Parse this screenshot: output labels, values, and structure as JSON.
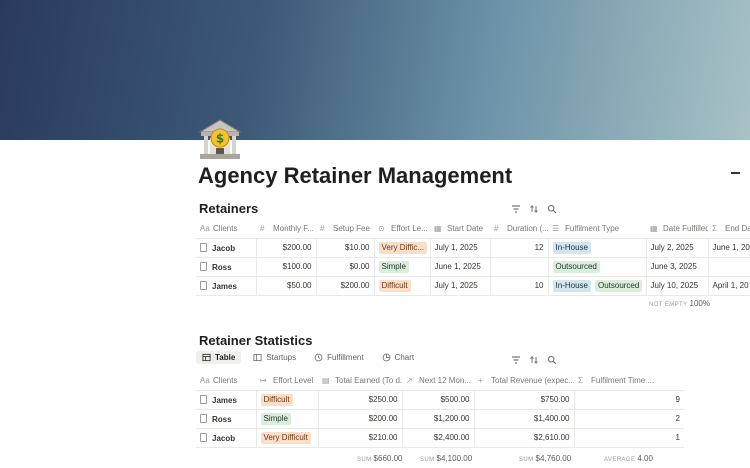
{
  "page": {
    "title": "Agency Retainer Management",
    "icon": "bank-icon"
  },
  "retainers": {
    "title": "Retainers",
    "columns": [
      {
        "label": "Clients",
        "icon": "Aa"
      },
      {
        "label": "Monthly F...",
        "icon": "#"
      },
      {
        "label": "Setup Fee",
        "icon": "#"
      },
      {
        "label": "Effort Le...",
        "icon": "⊙"
      },
      {
        "label": "Start Date",
        "icon": "▦"
      },
      {
        "label": "Duration (...",
        "icon": "#"
      },
      {
        "label": "Fulfilment Type",
        "icon": "☰"
      },
      {
        "label": "Date Fulfilled",
        "icon": "▦"
      },
      {
        "label": "End Da",
        "icon": "Σ"
      }
    ],
    "rows": [
      {
        "client": "Jacob",
        "monthly": "$200.00",
        "setup": "$10.00",
        "effort": "Very Diffic...",
        "start": "July 1, 2025",
        "duration": "12",
        "fulfilment": [
          "In-House"
        ],
        "fulfilled": "July 2, 2025",
        "end": "June 1, 20"
      },
      {
        "client": "Ross",
        "monthly": "$100.00",
        "setup": "$0.00",
        "effort": "Simple",
        "start": "June 1, 2025",
        "duration": "",
        "fulfilment": [
          "Outsourced"
        ],
        "fulfilled": "June 3, 2025",
        "end": ""
      },
      {
        "client": "James",
        "monthly": "$50.00",
        "setup": "$200.00",
        "effort": "Difficult",
        "start": "July 1, 2025",
        "duration": "10",
        "fulfilment": [
          "In-House",
          "Outsourced"
        ],
        "fulfilled": "July 10, 2025",
        "end": "April 1, 20"
      }
    ],
    "footer": {
      "label": "NOT EMPTY",
      "value": "100%"
    }
  },
  "statistics": {
    "title": "Retainer Statistics",
    "views": [
      "Table",
      "Startups",
      "Fulfillment",
      "Chart"
    ],
    "active_view": "Table",
    "columns": [
      {
        "label": "Clients",
        "icon": "Aa"
      },
      {
        "label": "Effort Level",
        "icon": "↦"
      },
      {
        "label": "Total Earned (To d...",
        "icon": "▤"
      },
      {
        "label": "Next 12 Mon...",
        "icon": "↗"
      },
      {
        "label": "Total Revenue (expec...",
        "icon": "+"
      },
      {
        "label": "Fulfilment Time ...",
        "icon": "Σ"
      }
    ],
    "rows": [
      {
        "client": "James",
        "effort": "Difficult",
        "earned": "$250.00",
        "next12": "$500.00",
        "revenue": "$750.00",
        "time": "9"
      },
      {
        "client": "Ross",
        "effort": "Simple",
        "earned": "$200.00",
        "next12": "$1,200.00",
        "revenue": "$1,400.00",
        "time": "2"
      },
      {
        "client": "Jacob",
        "effort": "Very Difficult",
        "earned": "$210.00",
        "next12": "$2,400.00",
        "revenue": "$2,610.00",
        "time": "1"
      }
    ],
    "footer": {
      "earned": {
        "label": "SUM",
        "value": "$660.00"
      },
      "next12": {
        "label": "SUM",
        "value": "$4,100.00"
      },
      "revenue": {
        "label": "SUM",
        "value": "$4,760.00"
      },
      "time": {
        "label": "AVERAGE",
        "value": "4.00"
      }
    }
  },
  "tag_colors": {
    "Very Diffic...": {
      "bg": "#fadec9",
      "fg": "#6b3a14"
    },
    "Very Difficult": {
      "bg": "#fadec9",
      "fg": "#6b3a14"
    },
    "Difficult": {
      "bg": "#fadec9",
      "fg": "#6b3a14"
    },
    "Simple": {
      "bg": "#dbeddb",
      "fg": "#1c3829"
    },
    "In-House": {
      "bg": "#d3e5ef",
      "fg": "#183347"
    },
    "Outsourced": {
      "bg": "#dbeddb",
      "fg": "#1c3829"
    }
  }
}
